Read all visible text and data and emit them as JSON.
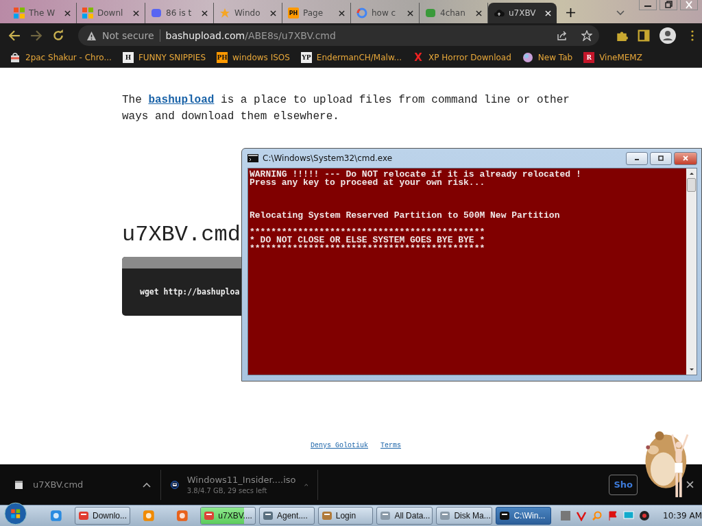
{
  "browser": {
    "tabs": [
      {
        "title": "The W",
        "kind": "windows",
        "selected": false
      },
      {
        "title": "Downl",
        "kind": "windows",
        "selected": false
      },
      {
        "title": "86 is t",
        "kind": "chat",
        "selected": false
      },
      {
        "title": "Windo",
        "kind": "star",
        "selected": false
      },
      {
        "title": "Page",
        "kind": "ph",
        "badge": "PH",
        "selected": false
      },
      {
        "title": "how c",
        "kind": "google",
        "selected": false
      },
      {
        "title": "4chan",
        "kind": "clover",
        "selected": false
      },
      {
        "title": "u7XBV",
        "kind": "cloud",
        "selected": true
      }
    ],
    "address": {
      "security": "Not secure",
      "host": "bashupload.com",
      "path": "/ABE8s/u7XBV.cmd"
    },
    "bookmarks": [
      {
        "label": "2pac Shakur - Chro...",
        "kind": "bag"
      },
      {
        "label": "FUNNY SNIPPIES",
        "kind": "square",
        "badge": "H"
      },
      {
        "label": "windows ISOS",
        "kind": "ph",
        "badge": "PH"
      },
      {
        "label": "EndermanCH/Malw...",
        "kind": "square",
        "badge": "YP"
      },
      {
        "label": "XP Horror Download",
        "kind": "cross",
        "badge": "X"
      },
      {
        "label": "New Tab",
        "kind": "ball"
      },
      {
        "label": "VineMEMZ",
        "kind": "red",
        "badge": "R"
      }
    ]
  },
  "page": {
    "intro": {
      "before": "The ",
      "link": "bashupload",
      "after": " is a place to upload files from command line or other ways and download them elsewhere."
    },
    "file_name": "u7XBV.cmd",
    "command": "wget http://bashuploa",
    "footer_links": [
      "Denys Golotiuk",
      "Terms"
    ]
  },
  "console": {
    "title": "C:\\Windows\\System32\\cmd.exe",
    "blocks": [
      [
        "WARNING !!!!! --- Do NOT relocate if it is already relocated !",
        "Press any key to proceed at your own risk..."
      ],
      [
        "Relocating System Reserved Partition to 500M New Partition"
      ],
      [
        "********************************************",
        "* DO NOT CLOSE OR ELSE SYSTEM GOES BYE BYE *",
        "********************************************"
      ]
    ]
  },
  "downloads": {
    "items": [
      {
        "kind": "file",
        "name": "u7XBV.cmd"
      },
      {
        "kind": "disc",
        "name": "Windows11_Insider....iso",
        "status": "3.8/4.7 GB, 29 secs left"
      }
    ],
    "show_all": "Sho"
  },
  "taskbar": {
    "items": [
      {
        "kind": "pinned"
      },
      {
        "kind": "window",
        "label": "Downlo...",
        "selected": false
      },
      {
        "kind": "pinned"
      },
      {
        "kind": "pinned"
      },
      {
        "kind": "window",
        "label": "u7XBV....",
        "selected": false,
        "level": 0.8
      },
      {
        "kind": "window",
        "label": "Agent....",
        "selected": false
      },
      {
        "kind": "window",
        "label": "Login",
        "selected": false
      },
      {
        "kind": "window",
        "label": "All Data...",
        "selected": false
      },
      {
        "kind": "window",
        "label": "Disk Ma...",
        "selected": false
      },
      {
        "kind": "window",
        "label": "C:\\Win...",
        "selected": true
      }
    ],
    "clock": "10:39 AM"
  }
}
